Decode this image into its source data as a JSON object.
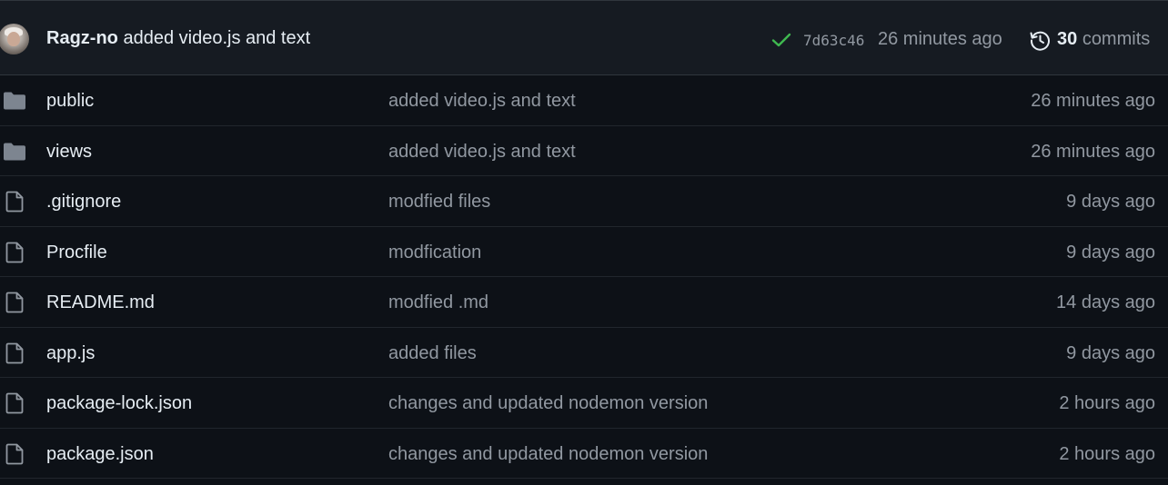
{
  "latest_commit": {
    "author": "Ragz-no",
    "message": "added video.js and text",
    "status": "success",
    "sha": "7d63c46",
    "time": "26 minutes ago",
    "commits_count": "30",
    "commits_label": "commits"
  },
  "files": [
    {
      "type": "folder",
      "name": "public",
      "message": "added video.js and text",
      "age": "26 minutes ago"
    },
    {
      "type": "folder",
      "name": "views",
      "message": "added video.js and text",
      "age": "26 minutes ago"
    },
    {
      "type": "file",
      "name": ".gitignore",
      "message": "modfied files",
      "age": "9 days ago"
    },
    {
      "type": "file",
      "name": "Procfile",
      "message": "modfication",
      "age": "9 days ago"
    },
    {
      "type": "file",
      "name": "README.md",
      "message": "modfied .md",
      "age": "14 days ago"
    },
    {
      "type": "file",
      "name": "app.js",
      "message": "added files",
      "age": "9 days ago"
    },
    {
      "type": "file",
      "name": "package-lock.json",
      "message": "changes and updated nodemon version",
      "age": "2 hours ago"
    },
    {
      "type": "file",
      "name": "package.json",
      "message": "changes and updated nodemon version",
      "age": "2 hours ago"
    }
  ],
  "icons": {
    "folder": "folder-icon",
    "file": "file-icon",
    "status": "check-icon",
    "history": "history-icon"
  },
  "colors": {
    "background": "#0d1117",
    "header_background": "#161b22",
    "success": "#3fb950",
    "muted_text": "#9198a1",
    "primary_text": "#e6edf3",
    "folder_icon": "#7d8590"
  }
}
